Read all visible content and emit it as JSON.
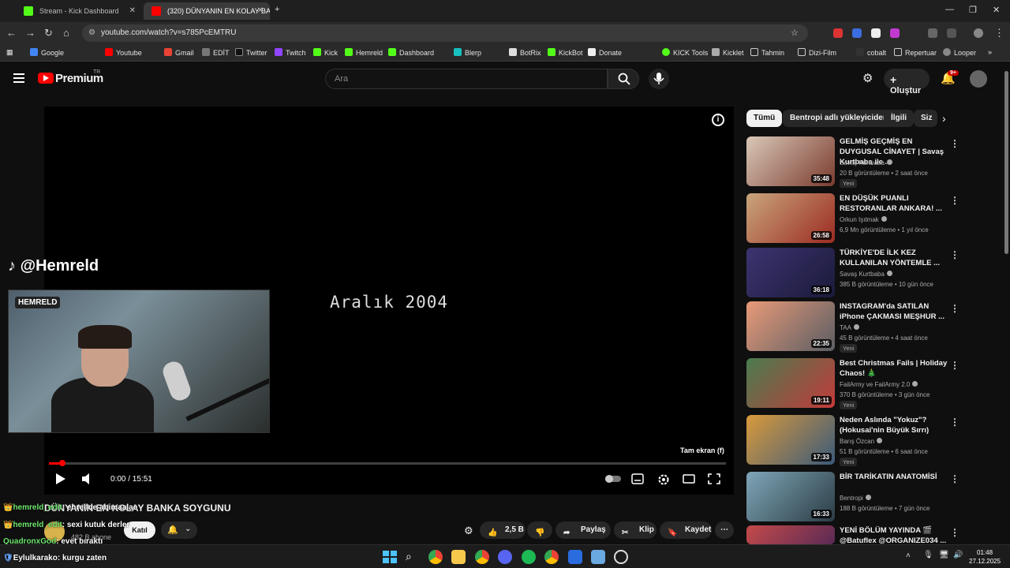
{
  "browser": {
    "tabs": [
      {
        "title": "Stream - Kick Dashboard",
        "active": false
      },
      {
        "title": "(320) DÜNYANIN EN KOLAY BA",
        "active": true
      }
    ],
    "url": "youtube.com/watch?v=s785PcEMTRU",
    "bookmarks": [
      "Google",
      "Youtube",
      "Gmail",
      "EDİT",
      "Twitter",
      "Twitch",
      "Kick",
      "Hemreld",
      "Dashboard",
      "Blerp",
      "BotRix",
      "KickBot",
      "Donate",
      "KICK Tools",
      "Kicklet",
      "Tahmin",
      "Dizi-Film",
      "cobalt",
      "Repertuar",
      "Looper"
    ]
  },
  "youtube": {
    "logo": "Premium",
    "region": "TR",
    "search_placeholder": "Ara",
    "create_label": "Oluştur",
    "notif_count": "9+"
  },
  "player": {
    "tiktok_handle": "@Hemreld",
    "cam_logo": "HEMRELD",
    "video_text": "Aralık 2004",
    "fullscreen_tip": "Tam ekran (f)",
    "time": "0:00 / 15:51",
    "progress_fraction": 0.02
  },
  "video": {
    "title": "DÜNYANIN EN KOLAY BANKA SOYGUNU",
    "subscribers": "482 B abone",
    "join_label": "Katıl",
    "likes": "2,5 B",
    "share_label": "Paylaş",
    "clip_label": "Klip",
    "save_label": "Kaydet"
  },
  "chat": [
    {
      "user": "hemreld_edit",
      "msg": "ehrellde ahimaalae"
    },
    {
      "user": "hemreld_edit",
      "msg": "sexi kutuk derler"
    },
    {
      "user": "QuadronxGod",
      "msg": "evet bıraktı"
    },
    {
      "user": "Eylulkarako",
      "msg": "kurgu zaten"
    }
  ],
  "chips": [
    "Tümü",
    "Bentropi adlı yükleyiciden",
    "İlgili",
    "Siz"
  ],
  "recommendations": [
    {
      "title": "GELMİŞ GEÇMİŞ EN DUYGUSAL CİNAYET | Savaş Kurtbaba ile ...",
      "channel": "Savaş Kurtbaba",
      "meta": "20 B görüntüleme • 2 saat önce",
      "duration": "35:48",
      "new": "Yeni",
      "color1": "#d9c8b8",
      "color2": "#7a3b2e"
    },
    {
      "title": "EN DÜŞÜK PUANLI RESTORANLAR ANKARA! ...",
      "channel": "Orkun Işıtmak",
      "meta": "6,9 Mn görüntüleme • 1 yıl önce",
      "duration": "26:58",
      "new": "",
      "color1": "#c9a57c",
      "color2": "#9c2b22"
    },
    {
      "title": "TÜRKİYE'DE İLK KEZ KULLANILAN YÖNTEMLE ...",
      "channel": "Savaş Kurtbaba",
      "meta": "385 B görüntüleme • 10 gün önce",
      "duration": "36:18",
      "new": "",
      "color1": "#3c3470",
      "color2": "#1b1a3a"
    },
    {
      "title": "INSTAGRAM'da SATILAN iPhone ÇAKMASI MEŞHUR ...",
      "channel": "TAA",
      "meta": "45 B görüntüleme • 4 saat önce",
      "duration": "22:35",
      "new": "Yeni",
      "color1": "#e89a78",
      "color2": "#5a5d63"
    },
    {
      "title": "Best Christmas Fails | Holiday Chaos! 🎄",
      "channel": "FailArmy ve FailArmy 2.0",
      "meta": "370 B görüntüleme • 3 gün önce",
      "duration": "19:11",
      "new": "Yeni",
      "color1": "#4a7c4f",
      "color2": "#c23a3a"
    },
    {
      "title": "Neden Aslında \"Yokuz\"? (Hokusai'nin Büyük Sırrı)",
      "channel": "Barış Özcan",
      "meta": "51 B görüntüleme • 6 saat önce",
      "duration": "17:33",
      "new": "Yeni",
      "color1": "#d99a3c",
      "color2": "#3a5a7a"
    },
    {
      "title": "BİR TARİKATIN ANATOMİSİ",
      "channel": "Bentropi",
      "meta": "188 B görüntüleme • 7 gün önce",
      "duration": "16:33",
      "new": "",
      "color1": "#7fa6b8",
      "color2": "#2b3c44"
    },
    {
      "title": "YENİ BÖLÜM YAYINDA 🎬 @Batuflex @ORGANIZE034 ...",
      "channel": "",
      "meta": "",
      "duration": "",
      "new": "",
      "color1": "#c44a4a",
      "color2": "#5a2a55"
    }
  ],
  "clock": {
    "time": "01:48",
    "date": "27.12.2025"
  }
}
